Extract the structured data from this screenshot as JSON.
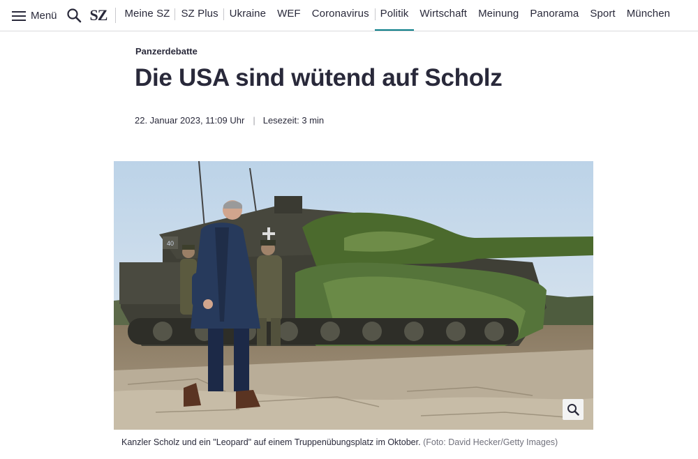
{
  "nav": {
    "menu_label": "Menü",
    "logo": "SZ",
    "items": [
      "Meine SZ",
      "SZ Plus",
      "Ukraine",
      "WEF",
      "Coronavirus",
      "Politik",
      "Wirtschaft",
      "Meinung",
      "Panorama",
      "Sport",
      "München"
    ],
    "active_item": "Politik",
    "accent_color": "#0a7e88",
    "icons": [
      "hamburger-icon",
      "search-icon"
    ]
  },
  "article": {
    "kicker": "Panzerdebatte",
    "headline": "Die USA sind wütend auf Scholz",
    "date": "22. Januar 2023, 11:09 Uhr",
    "divider": "|",
    "reading_time": "Lesezeit: 3 min"
  },
  "image": {
    "tank_number": "40",
    "caption": "Kanzler Scholz und ein \"Leopard\" auf einem Truppenübungsplatz im Oktober.",
    "credit": "(Foto: David Hecker/Getty Images)",
    "zoom_icon": "magnifier-icon"
  }
}
